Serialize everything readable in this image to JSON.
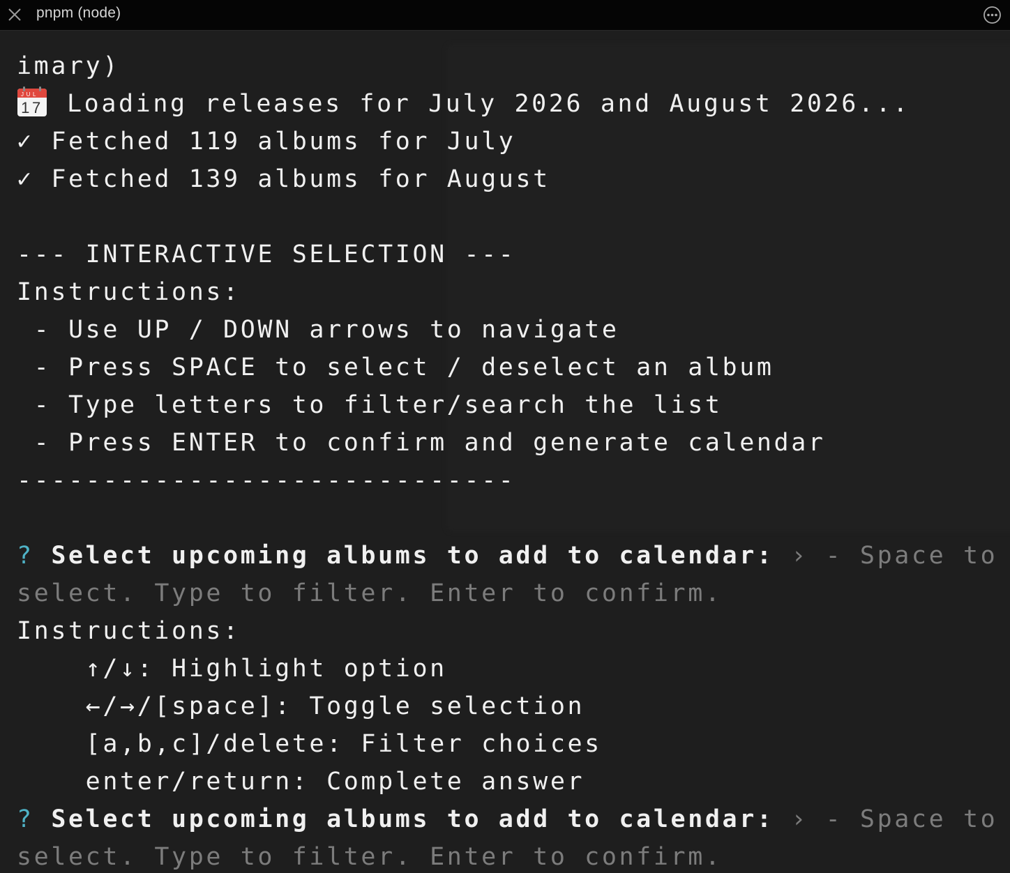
{
  "window": {
    "title": "pnpm (node)",
    "icons": [
      "close-icon",
      "more-icon"
    ]
  },
  "terminal": {
    "lines": {
      "l0": "imary)",
      "l1": "Loading releases for July 2026 and August 2026...",
      "l1_icon": "calendar-icon",
      "l1_icon_month": "JUL",
      "l1_icon_day": "17",
      "l2": "✓ Fetched 119 albums for July",
      "l3": "✓ Fetched 139 albums for August",
      "l4": "",
      "l5": "--- INTERACTIVE SELECTION ---",
      "l6": "Instructions:",
      "l7": " - Use UP / DOWN arrows to navigate",
      "l8": " - Press SPACE to select / deselect an album",
      "l9": " - Type letters to filter/search the list",
      "l10": " - Press ENTER to confirm and generate calendar",
      "l11": "-----------------------------",
      "l12": "",
      "prompt1": {
        "marker": "?",
        "question": "Select upcoming albums to add to calendar:",
        "hint_line1": "› - Space to",
        "hint_line2": "select. Type to filter. Enter to confirm."
      },
      "l15": "Instructions:",
      "l16": "    ↑/↓: Highlight option",
      "l17": "    ←/→/[space]: Toggle selection",
      "l18": "    [a,b,c]/delete: Filter choices",
      "l19": "    enter/return: Complete answer",
      "prompt2": {
        "marker": "?",
        "question": "Select upcoming albums to add to calendar:",
        "hint_line1": "› - Space to",
        "hint_line2": "select. Type to filter. Enter to confirm."
      }
    }
  },
  "colors": {
    "background": "#1e1e1e",
    "titlebar": "#050505",
    "text": "#f0f0f0",
    "prompt_marker": "#4fb3c7",
    "hint": "#7c7c7c",
    "calendar_red": "#e0483e"
  }
}
